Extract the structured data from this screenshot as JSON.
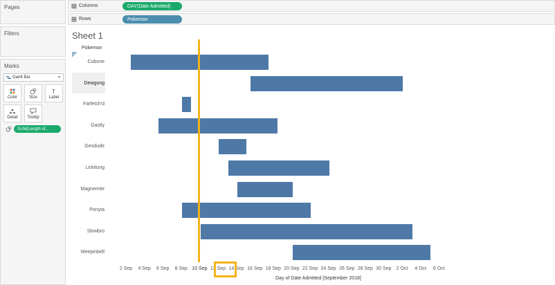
{
  "panes": {
    "pages": "Pages",
    "filters": "Filters",
    "marks": "Marks",
    "mark_type": "Gantt Bar",
    "buttons": [
      {
        "label": "Color",
        "icon": "color-dots-icon"
      },
      {
        "label": "Size",
        "icon": "size-icon"
      },
      {
        "label": "Label",
        "icon": "label-icon"
      },
      {
        "label": "Detail",
        "icon": "detail-icon"
      },
      {
        "label": "Tooltip",
        "icon": "tooltip-icon"
      }
    ],
    "measure_pill": "SUM(Length of..."
  },
  "shelves": {
    "columns_label": "Columns",
    "columns_pill": "DAY(Date Admitted)",
    "rows_label": "Rows",
    "rows_pill": "Pokemon"
  },
  "sheet": {
    "title": "Sheet 1",
    "row_header": "Pokemon"
  },
  "colors": {
    "bar": "#4e79a7",
    "reference": "#f5b31b",
    "dimension_pill": "#4b8eae",
    "measure_pill": "#1aaa6c"
  },
  "chart_data": {
    "type": "gantt",
    "xlabel": "Day of Date Admitted [September 2018]",
    "x_ticks": [
      "2 Sep",
      "4 Sep",
      "6 Sep",
      "8 Sep",
      "10 Sep",
      "12 Sep",
      "14 Sep",
      "16 Sep",
      "18 Sep",
      "20 Sep",
      "22 Sep",
      "24 Sep",
      "26 Sep",
      "28 Sep",
      "30 Sep",
      "2 Oct",
      "4 Oct",
      "6 Oct"
    ],
    "x_range_days": [
      1,
      37
    ],
    "highlighted_tick": "10 Sep",
    "reference_day": 9.9,
    "categories": [
      "Cubone",
      "Dewgong",
      "Farfetch'd",
      "Gastly",
      "Geodude",
      "Lickitung",
      "Magnemite",
      "Ponyta",
      "Slowbro",
      "Weepinbell"
    ],
    "bars": [
      {
        "name": "Cubone",
        "start": 2.5,
        "end": 17.5
      },
      {
        "name": "Dewgong",
        "start": 15.5,
        "end": 32.1
      },
      {
        "name": "Farfetch'd",
        "start": 8.1,
        "end": 9.1
      },
      {
        "name": "Gastly",
        "start": 5.5,
        "end": 18.5
      },
      {
        "name": "Geodude",
        "start": 12.1,
        "end": 15.1
      },
      {
        "name": "Lickitung",
        "start": 13.1,
        "end": 24.1
      },
      {
        "name": "Magnemite",
        "start": 14.1,
        "end": 20.1
      },
      {
        "name": "Ponyta",
        "start": 8.1,
        "end": 22.1
      },
      {
        "name": "Slowbro",
        "start": 10.1,
        "end": 33.1
      },
      {
        "name": "Weepinbell",
        "start": 20.1,
        "end": 35.1
      }
    ]
  }
}
